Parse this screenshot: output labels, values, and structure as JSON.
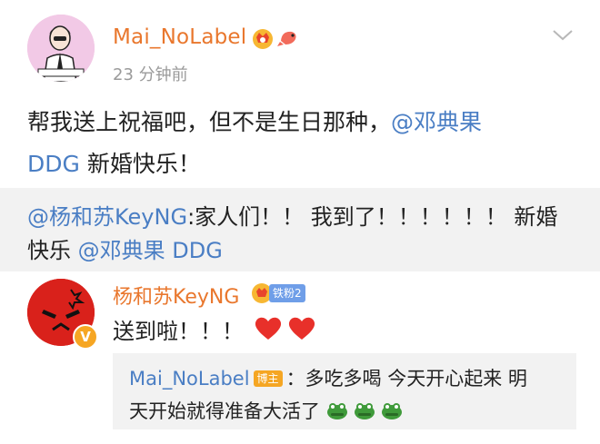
{
  "post": {
    "author": "Mai_NoLabel",
    "time": "23 分钟前",
    "text_before": "帮我送上祝福吧，但不是生日那种，",
    "mention": "@邓典果",
    "mention_line2": "DDG",
    "text_after": " 新婚快乐！"
  },
  "repost": {
    "mention_user": "@杨和苏KeyNG",
    "text": ":家人们！！ 我到了！！！！！！ 新婚快乐 ",
    "mention_end": "@邓典果 DDG"
  },
  "comment": {
    "author": "杨和苏KeyNG",
    "fan_tag": "铁粉2",
    "vip_mark": "V",
    "text": "送到啦！！！",
    "reply": {
      "author": "Mai_NoLabel",
      "op_tag": "博主",
      "line1": "：多吃多喝 今天开心起来 明",
      "line2": "天开始就得准备大活了"
    }
  },
  "icons": [
    "crown-icon",
    "shrimp-icon",
    "chevron-down-icon",
    "heart-icon",
    "frog-emoji-icon"
  ],
  "colors": {
    "name_orange": "#e9772d",
    "link_blue": "#4a7ec4",
    "time_gray": "#9a9a9a",
    "box_gray": "#f2f2f2"
  }
}
